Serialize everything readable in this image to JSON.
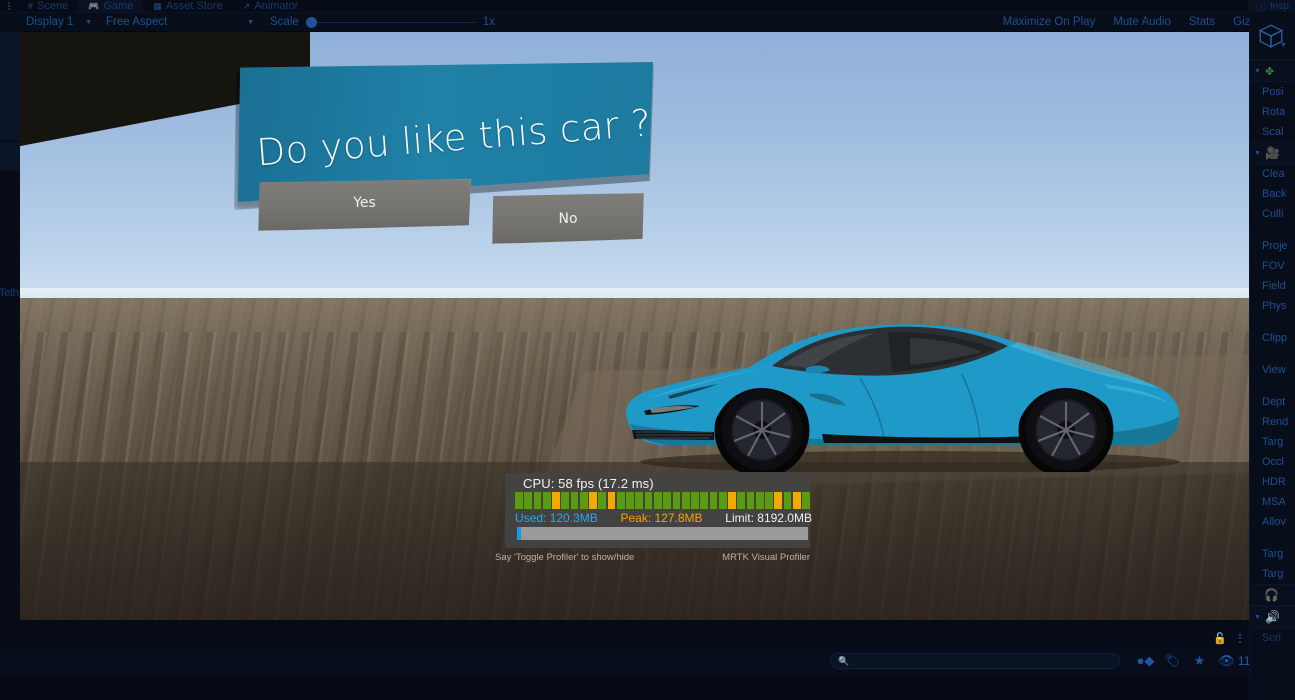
{
  "window": {
    "tabs": [
      {
        "label": "Scene",
        "icon": "grid-icon",
        "active": false
      },
      {
        "label": "Game",
        "icon": "gamepad-icon",
        "active": true
      },
      {
        "label": "Asset Store",
        "icon": "store-icon",
        "active": false
      },
      {
        "label": "Animator",
        "icon": "animator-icon",
        "active": false
      }
    ]
  },
  "toolbar": {
    "display": "Display 1",
    "aspect": "Free Aspect",
    "scale_label": "Scale",
    "scale_value": "1x",
    "maximize_on_play": "Maximize On Play",
    "mute_audio": "Mute Audio",
    "stats": "Stats",
    "gizmos": "Gizmos"
  },
  "left_rail": {
    "clipped_label": "Teth"
  },
  "game": {
    "dialog": {
      "question": "Do you like this car ?",
      "yes": "Yes",
      "no": "No",
      "panel_color": "#1d7ba0",
      "button_color": "#74736f"
    },
    "car": {
      "body_color": "#1f9ac8",
      "body_shadow": "#12627f",
      "wheel_color": "#15151a"
    },
    "profiler": {
      "cpu": "CPU: 58 fps (17.2 ms)",
      "used_label": "Used:",
      "used_value": "120.3MB",
      "peak_label": "Peak:",
      "peak_value": "127.8MB",
      "limit_label": "Limit:",
      "limit_value": "8192.0MB",
      "hint": "Say 'Toggle Profiler' to show/hide",
      "brand": "MRTK Visual Profiler",
      "color_good": "#5a9b12",
      "color_warn": "#f2a900",
      "color_used": "#29a9e8",
      "frame_bars": [
        "good",
        "good",
        "good",
        "good",
        "warn",
        "good",
        "good",
        "good",
        "warn",
        "good",
        "warn",
        "good",
        "good",
        "good",
        "good",
        "good",
        "good",
        "good",
        "good",
        "good",
        "good",
        "good",
        "good",
        "warn",
        "good",
        "good",
        "good",
        "good",
        "warn",
        "good",
        "warn",
        "good"
      ],
      "memory_fill_percent": 1.47
    }
  },
  "bottom": {
    "search_placeholder": "",
    "search_value": "",
    "hidden_count": "11",
    "icons": [
      "lock-icon",
      "kebab-icon",
      "search-icon",
      "avatar-icon",
      "tag-icon",
      "star-icon",
      "eye-off-icon"
    ]
  },
  "inspector": {
    "tab_label": "Insp",
    "rows": [
      {
        "text": "Posi",
        "type": "field"
      },
      {
        "text": "Rota",
        "type": "field"
      },
      {
        "text": "Scal",
        "type": "field"
      },
      {
        "text": "Clea",
        "type": "field"
      },
      {
        "text": "Back",
        "type": "field"
      },
      {
        "text": "Culli",
        "type": "field"
      },
      {
        "text": "Proje",
        "type": "field"
      },
      {
        "text": "FOV",
        "type": "field"
      },
      {
        "text": "Field",
        "type": "field"
      },
      {
        "text": "Phys",
        "type": "field"
      },
      {
        "text": "Clipp",
        "type": "field"
      },
      {
        "text": "View",
        "type": "field"
      },
      {
        "text": "Dept",
        "type": "field"
      },
      {
        "text": "Rend",
        "type": "field"
      },
      {
        "text": "Targ",
        "type": "field"
      },
      {
        "text": "Occl",
        "type": "field"
      },
      {
        "text": "HDR",
        "type": "field"
      },
      {
        "text": "MSA",
        "type": "field"
      },
      {
        "text": "Allov",
        "type": "field"
      },
      {
        "text": "Targ",
        "type": "field"
      },
      {
        "text": "Targ",
        "type": "field"
      },
      {
        "text": "Scri",
        "type": "field"
      }
    ],
    "sections": [
      "transform-section",
      "camera-section",
      "audio-listener-section",
      "audio-source-section"
    ]
  }
}
